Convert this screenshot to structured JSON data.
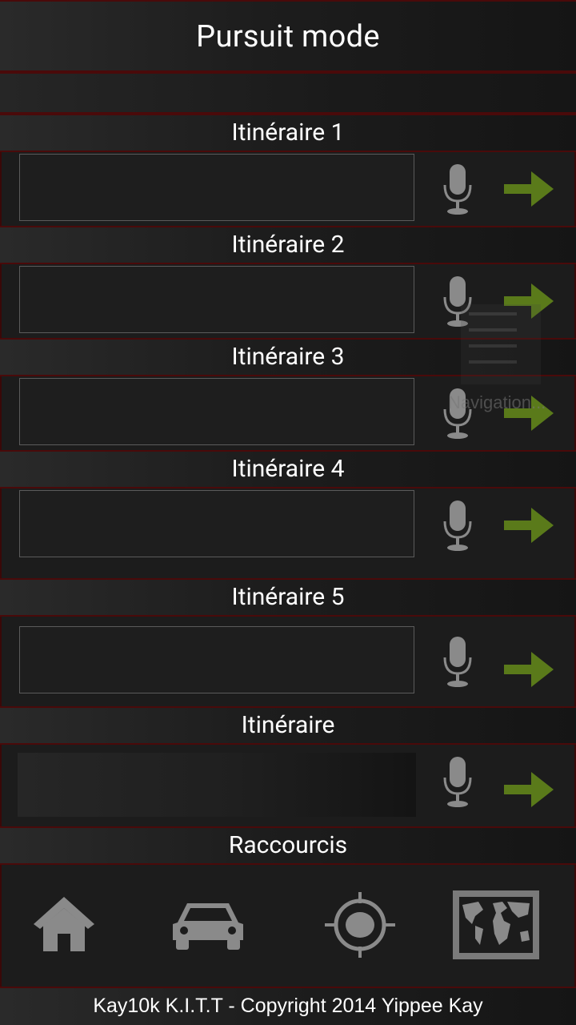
{
  "header": {
    "title": "Pursuit mode"
  },
  "routes": [
    {
      "label": "Itinéraire 1",
      "value": "",
      "placeholder": ""
    },
    {
      "label": "Itinéraire 2",
      "value": "",
      "placeholder": ""
    },
    {
      "label": "Itinéraire 3",
      "value": "",
      "placeholder": ""
    },
    {
      "label": "Itinéraire 4",
      "value": "",
      "placeholder": ""
    },
    {
      "label": "Itinéraire 5",
      "value": "",
      "placeholder": ""
    }
  ],
  "route_generic": {
    "label": "Itinéraire"
  },
  "shortcuts": {
    "label": "Raccourcis",
    "items": [
      {
        "icon": "home-icon"
      },
      {
        "icon": "car-icon"
      },
      {
        "icon": "location-target-icon"
      },
      {
        "icon": "world-map-icon"
      }
    ]
  },
  "overlay": {
    "text": "Navigation..."
  },
  "footer": {
    "text": "Kay10k  K.I.T.T - Copyright 2014 Yippee Kay"
  },
  "colors": {
    "accent_border": "#4a0a0a",
    "arrow": "#5a7a1a",
    "icon_gray": "#8a8a8a"
  }
}
